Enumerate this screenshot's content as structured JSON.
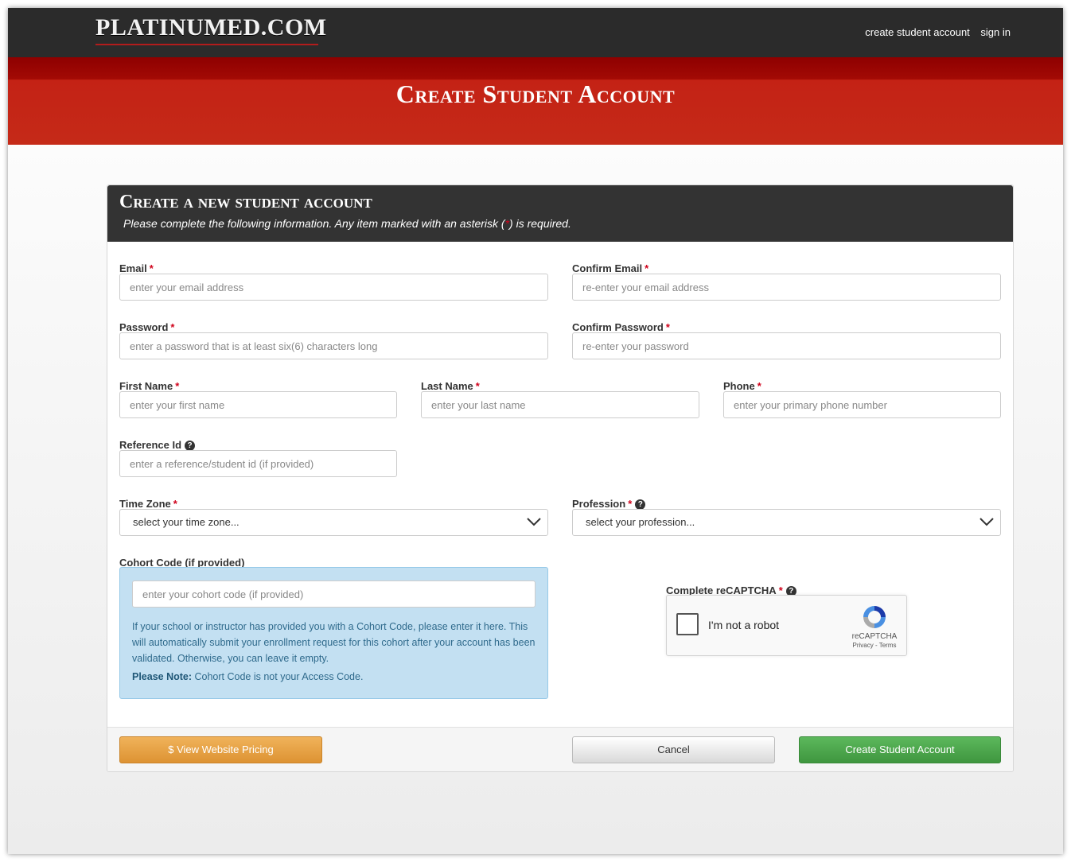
{
  "header": {
    "logo": "PLATINUMED.COM",
    "nav": [
      "create student account",
      "sign in"
    ]
  },
  "banner": {
    "title": "Create Student Account"
  },
  "card": {
    "title": "Create a new student account",
    "subtitle_prefix": "Please complete the following information. Any item marked with an asterisk (",
    "subtitle_star": "*",
    "subtitle_suffix": ") is required."
  },
  "form": {
    "email": {
      "label": "Email",
      "placeholder": "enter your email address"
    },
    "confirm_email": {
      "label": "Confirm Email",
      "placeholder": "re-enter your email address"
    },
    "password": {
      "label": "Password",
      "placeholder": "enter a password that is at least six(6) characters long"
    },
    "confirm_password": {
      "label": "Confirm Password",
      "placeholder": "re-enter your password"
    },
    "first_name": {
      "label": "First Name",
      "placeholder": "enter your first name"
    },
    "last_name": {
      "label": "Last Name",
      "placeholder": "enter your last name"
    },
    "phone": {
      "label": "Phone",
      "placeholder": "enter your primary phone number"
    },
    "reference_id": {
      "label": "Reference Id",
      "placeholder": "enter a reference/student id (if provided)"
    },
    "time_zone": {
      "label": "Time Zone",
      "selected": "select your time zone..."
    },
    "profession": {
      "label": "Profession",
      "selected": "select your profession..."
    },
    "cohort": {
      "label": "Cohort Code (if provided)",
      "placeholder": "enter your cohort code (if provided)",
      "help": "If your school or instructor has provided you with a Cohort Code, please enter it here. This will automatically submit your enrollment request for this cohort after your account has been validated. Otherwise, you can leave it empty.",
      "note_label": "Please Note:",
      "note_text": " Cohort Code is not your Access Code."
    },
    "required_mark": "*",
    "help_glyph": "?"
  },
  "captcha": {
    "label": "Complete reCAPTCHA",
    "checkbox_text": "I'm not a robot",
    "brand": "reCAPTCHA",
    "links": "Privacy - Terms"
  },
  "buttons": {
    "pricing": "$ View Website Pricing",
    "cancel": "Cancel",
    "create": "Create Student Account"
  },
  "colors": {
    "header_bg": "#2b2b2b",
    "banner_red": "#c42215",
    "required": "#d0021b",
    "pricing": "#e6a040",
    "create": "#4cae4c",
    "cohort_bg": "#c3e0f2"
  }
}
